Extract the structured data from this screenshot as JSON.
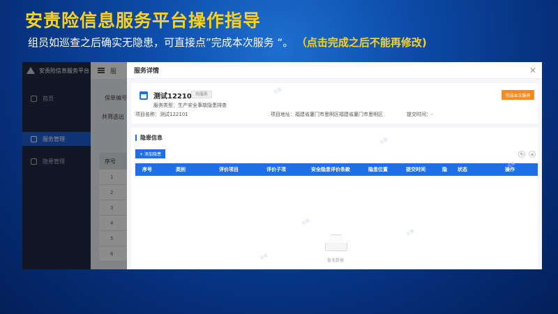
{
  "slide": {
    "title": "安责险信息服务平台操作指导",
    "subtitle": "组员如巡查之后确实无隐患，可直接点”完成本次服务 “。",
    "highlight": "（点击完成之后不能再修改)"
  },
  "app": {
    "name": "安责险信息服务平台",
    "topbar_text": "服",
    "sidebar": {
      "items": [
        {
          "label": "首页"
        },
        {
          "label": "服务管理",
          "active": true
        },
        {
          "label": "隐患管理"
        }
      ]
    },
    "background": {
      "filter_label": "保单编号",
      "list_label": "共筛选出",
      "table_header": "序号",
      "rows": [
        "1",
        "2",
        "3",
        "4",
        "5",
        "6"
      ]
    }
  },
  "drawer": {
    "title": "服务详情",
    "project": {
      "name": "测试122101",
      "status": "待服务",
      "service_type": "服务类型：生产安全事故隐患排查",
      "complete_button": "完成本次服务",
      "project_name": "项目名称：测试122101",
      "address": "项目地址：福建省厦门市思明区福建省厦门市思明区",
      "submit_time": "提交时间：-"
    },
    "hazards": {
      "section_title": "隐患信息",
      "add_button": "+ 添加隐患",
      "columns": [
        "序号",
        "类别",
        "评价项目",
        "评价子项",
        "安全隐患评价条款",
        "隐患位置",
        "提交时间",
        "隐",
        "状态",
        "操作"
      ],
      "empty_text": "暂无数据"
    },
    "watermark": "云安"
  }
}
